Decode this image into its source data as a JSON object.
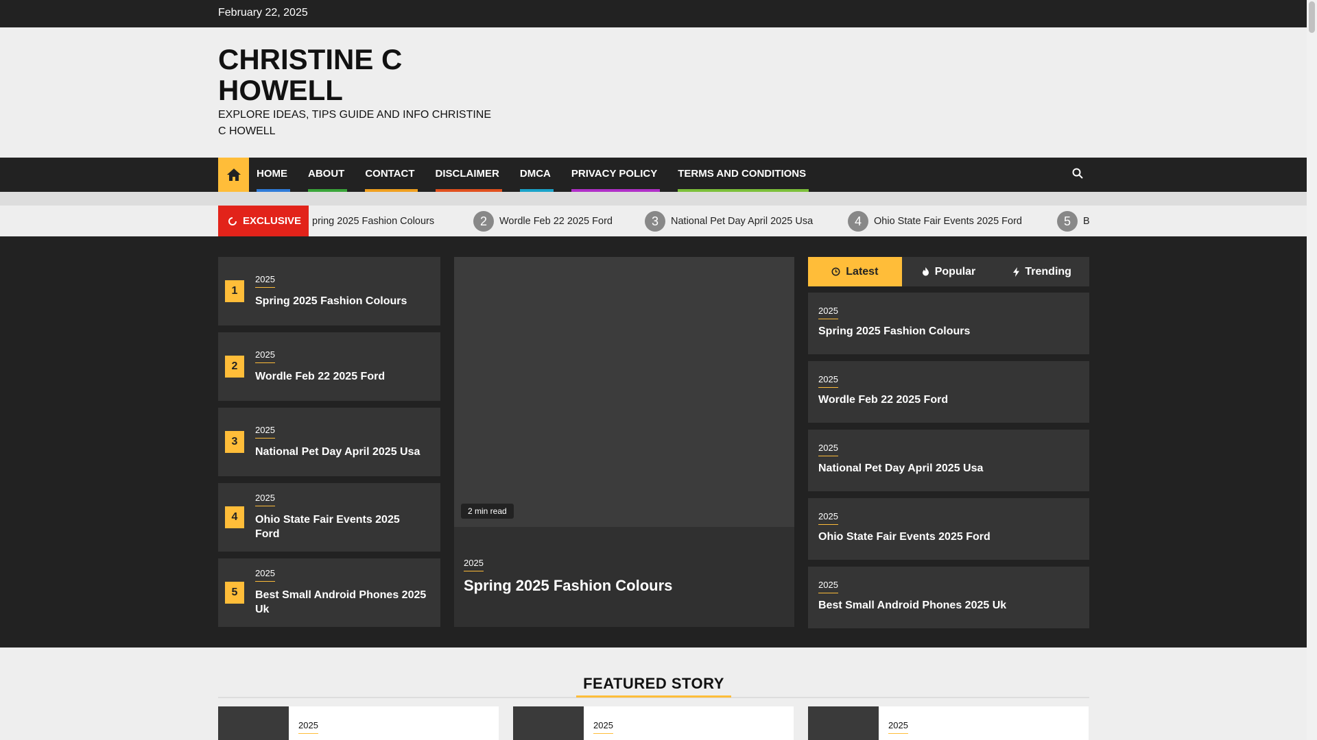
{
  "topbar": {
    "date": "February 22, 2025"
  },
  "site": {
    "title": "CHRISTINE C HOWELL",
    "description": "EXPLORE IDEAS, TIPS GUIDE AND INFO CHRISTINE C HOWELL"
  },
  "nav": {
    "items": [
      {
        "label": "HOME",
        "color": "#2f7bd8"
      },
      {
        "label": "ABOUT",
        "color": "#3aa53a"
      },
      {
        "label": "CONTACT",
        "color": "#f0a020"
      },
      {
        "label": "DISCLAIMER",
        "color": "#e0501e"
      },
      {
        "label": "DMCA",
        "color": "#1aa3c9"
      },
      {
        "label": "PRIVACY POLICY",
        "color": "#b030c8"
      },
      {
        "label": "TERMS AND CONDITIONS",
        "color": "#7cc03a"
      }
    ]
  },
  "ticker": {
    "label": "EXCLUSIVE",
    "items": [
      {
        "num": "",
        "title": "pring 2025 Fashion Colours"
      },
      {
        "num": "2",
        "title": "Wordle Feb 22 2025 Ford"
      },
      {
        "num": "3",
        "title": "National Pet Day April 2025 Usa"
      },
      {
        "num": "4",
        "title": "Ohio State Fair Events 2025 Ford"
      },
      {
        "num": "5",
        "title": "Be"
      }
    ]
  },
  "left_list": [
    {
      "num": "1",
      "category": "2025",
      "title": "Spring 2025 Fashion Colours"
    },
    {
      "num": "2",
      "category": "2025",
      "title": "Wordle Feb 22 2025 Ford"
    },
    {
      "num": "3",
      "category": "2025",
      "title": "National Pet Day April 2025 Usa"
    },
    {
      "num": "4",
      "category": "2025",
      "title": "Ohio State Fair Events 2025 Ford"
    },
    {
      "num": "5",
      "category": "2025",
      "title": "Best Small Android Phones 2025 Uk"
    }
  ],
  "main_story": {
    "read_time": "2 min read",
    "category": "2025",
    "title": "Spring 2025 Fashion Colours"
  },
  "tabs": [
    {
      "label": "Latest",
      "icon": "clock-icon"
    },
    {
      "label": "Popular",
      "icon": "fire-icon"
    },
    {
      "label": "Trending",
      "icon": "bolt-icon"
    }
  ],
  "right_list": [
    {
      "category": "2025",
      "title": "Spring 2025 Fashion Colours"
    },
    {
      "category": "2025",
      "title": "Wordle Feb 22 2025 Ford"
    },
    {
      "category": "2025",
      "title": "National Pet Day April 2025 Usa"
    },
    {
      "category": "2025",
      "title": "Ohio State Fair Events 2025 Ford"
    },
    {
      "category": "2025",
      "title": "Best Small Android Phones 2025 Uk"
    }
  ],
  "featured": {
    "heading": "FEATURED STORY",
    "cards": [
      {
        "category": "2025"
      },
      {
        "category": "2025"
      },
      {
        "category": "2025"
      }
    ]
  },
  "colors": {
    "accent": "#ffbd39",
    "dark": "#222222",
    "exclusive": "#e2231a"
  }
}
